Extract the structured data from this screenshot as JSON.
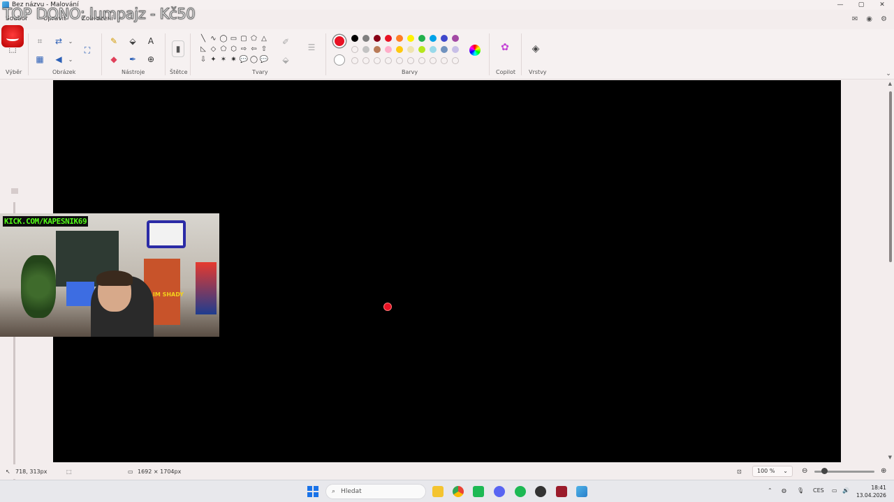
{
  "window": {
    "title": "Bez názvu - Malování",
    "minimize": "—",
    "maximize": "▢",
    "close": "✕"
  },
  "overlay": {
    "donation": "TOP DONO: lumpajz - Kč50",
    "kick": "KICK.COM/KAPESNIK69",
    "jersey": "SLIM SHADY"
  },
  "menu": {
    "file": "Soubor",
    "edit": "Upravit",
    "view": "Zobrazení"
  },
  "ribbon": {
    "groups": {
      "selection": "Výběr",
      "image": "Obrázek",
      "tools": "Nástroje",
      "brushes": "Štětce",
      "shapes": "Tvary",
      "colors": "Barvy",
      "copilot": "Copilot",
      "layers": "Vrstvy"
    },
    "shapes": [
      "╲",
      "∿",
      "◯",
      "▭",
      "▢",
      "⬠",
      "△",
      "◺",
      "◇",
      "⬠",
      "⬡",
      "⇨",
      "⇦",
      "⇧",
      "⇩",
      "✦",
      "✶",
      "✷",
      "💬",
      "◯",
      "💬"
    ],
    "primary_color": "#e81224",
    "secondary_color": "#ffffff",
    "palette": [
      "#000000",
      "#7f7f7f",
      "#880015",
      "#e81224",
      "#ff7f27",
      "#fff200",
      "#22b14c",
      "#00a2e8",
      "#3f48cc",
      "#a349a4",
      "empty",
      "#c3c3c3",
      "#b97a57",
      "#ffaec9",
      "#ffc90e",
      "#efe4b0",
      "#b5e61d",
      "#99d9ea",
      "#7092be",
      "#c8bfe7",
      "empty",
      "empty",
      "empty",
      "empty",
      "empty",
      "empty",
      "empty",
      "empty",
      "empty",
      "empty"
    ]
  },
  "status": {
    "cursor_pos": "718, 313px",
    "canvas_size": "1692 × 1704px",
    "zoom": "100 %"
  },
  "taskbar": {
    "search_placeholder": "Hledat",
    "lang": "CES",
    "time": "18:41",
    "date": "13.04.2026"
  }
}
